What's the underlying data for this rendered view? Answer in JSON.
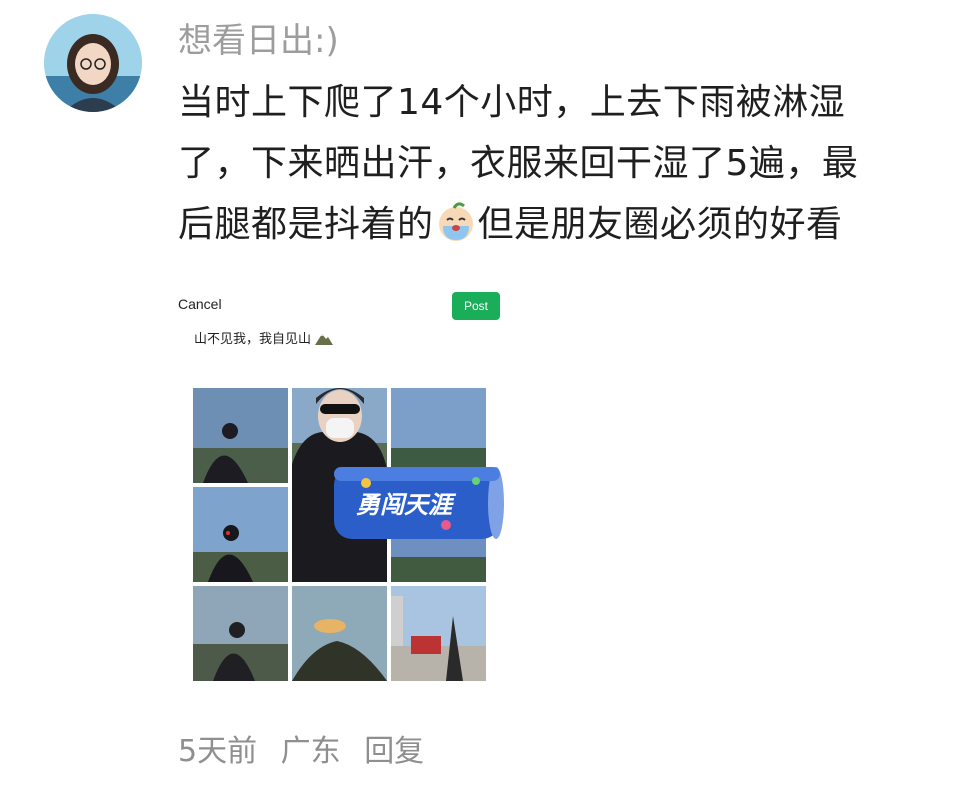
{
  "comment": {
    "username": "想看日出:)",
    "text_line1": "当时上下爬了14个小时，上去下雨被淋湿",
    "text_line2": "了，下来晒出汗，衣服来回干湿了5遍，最",
    "text_line3_before": "后腿都是抖着的",
    "text_line3_after": "但是朋友圈必须的好看",
    "emoji": "crying-face-emoji",
    "time": "5天前",
    "location": "广东",
    "reply_label": "回复"
  },
  "screenshot": {
    "cancel_label": "Cancel",
    "post_label": "Post",
    "caption": "山不见我，我自见山",
    "can_text": "勇闯天涯",
    "photos": [
      "photo-1",
      "photo-2",
      "photo-3",
      "photo-4",
      "photo-5",
      "photo-6",
      "photo-7",
      "photo-8",
      "photo-9"
    ]
  },
  "colors": {
    "post_button": "#1aad5a",
    "muted_text": "#9d9d9d",
    "body_text": "#1f1f1f"
  }
}
